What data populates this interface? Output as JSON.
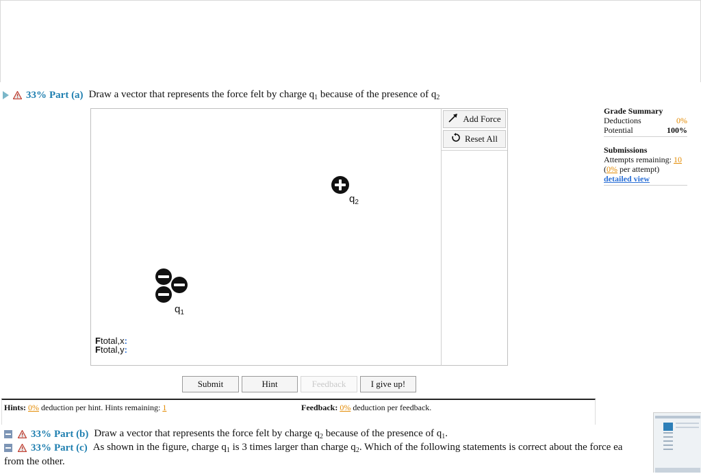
{
  "part_a": {
    "percent": "33%",
    "label": "Part (a)",
    "question_pre": "Draw a vector that represents the force felt by charge q",
    "question_sub1": "1",
    "question_mid": " because of the presence of q",
    "question_sub2": "2"
  },
  "tools": {
    "add_force": "Add Force",
    "reset_all": "Reset All"
  },
  "charges": {
    "q2": {
      "name": "q",
      "sub": "2",
      "sign": "+"
    },
    "q1": {
      "name": "q",
      "sub": "1",
      "sign": "−"
    }
  },
  "ftotal": {
    "x": {
      "f": "F",
      "label": "total,x",
      "colon": ":"
    },
    "y": {
      "f": "F",
      "label": "total,y",
      "colon": ":"
    }
  },
  "actions": {
    "submit": "Submit",
    "hint": "Hint",
    "feedback": "Feedback",
    "give_up": "I give up!"
  },
  "hints": {
    "label": "Hints:",
    "pct": "0%",
    "text": "deduction per hint. Hints remaining:",
    "remaining": "1"
  },
  "feedback_info": {
    "label": "Feedback:",
    "pct": "0%",
    "text": "deduction per feedback."
  },
  "grade_summary": {
    "title": "Grade Summary",
    "deductions_label": "Deductions",
    "deductions_value": "0%",
    "potential_label": "Potential",
    "potential_value": "100%",
    "submissions_title": "Submissions",
    "attempts_label": "Attempts remaining:",
    "attempts_value": "10",
    "per_attempt_pct": "0%",
    "per_attempt_text": "per attempt)",
    "detailed_view": "detailed view"
  },
  "part_b": {
    "percent": "33%",
    "label": "Part (b)",
    "q_pre": "Draw a vector that represents the force felt by charge q",
    "sub1": "2",
    "q_mid": " because of the presence of q",
    "sub2": "1",
    "q_end": "."
  },
  "part_c": {
    "percent": "33%",
    "label": "Part (c)",
    "q_pre": "As shown in the figure, charge q",
    "sub1": "1",
    "q_mid": " is 3 times larger than charge q",
    "sub2": "2",
    "q_end": ". Which of the following statements is correct about the force ea",
    "continuation": "from the other."
  },
  "colors": {
    "part_label": "#1f7fb0",
    "orange": "#e38a00",
    "blue": "#2a6fd6",
    "minus_box": "#7d95b5"
  }
}
